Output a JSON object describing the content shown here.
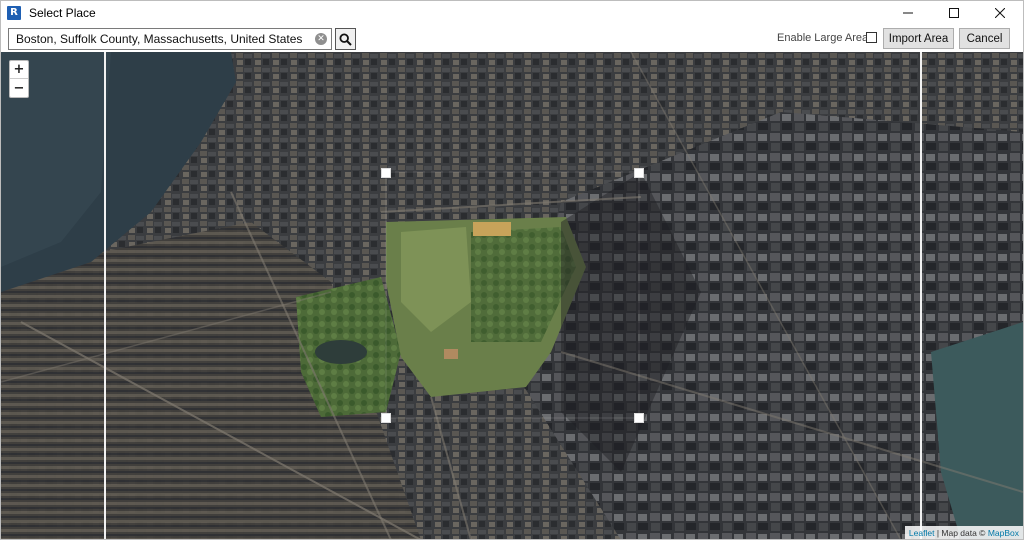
{
  "window": {
    "title": "Select Place",
    "icon_letter": "R",
    "controls": {
      "minimize": "minimize-icon",
      "maximize": "maximize-icon",
      "close": "close-icon"
    }
  },
  "toolbar": {
    "search_value": "Boston, Suffolk County, Massachusetts, United States of America",
    "enable_large_areas_label": "Enable Large Areas",
    "enable_large_areas_checked": false,
    "import_label": "Import Area",
    "cancel_label": "Cancel"
  },
  "map": {
    "zoom_in": "+",
    "zoom_out": "−",
    "attribution": {
      "leaflet": "Leaflet",
      "separator": " | Map data © ",
      "provider": "MapBox"
    }
  },
  "colors": {
    "accent": "#1e5fb3",
    "water": "#3a4a54",
    "park": "#4f6b3a",
    "link": "#0078a8"
  }
}
